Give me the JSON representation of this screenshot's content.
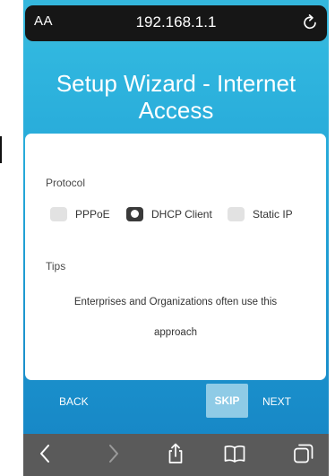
{
  "browser": {
    "text_size_button": "AA",
    "url": "192.168.1.1",
    "reload_icon": "reload-icon"
  },
  "page": {
    "title": "Setup Wizard - Internet Access"
  },
  "protocol": {
    "label": "Protocol",
    "options": [
      {
        "label": "PPPoE",
        "selected": false
      },
      {
        "label": "DHCP Client",
        "selected": true
      },
      {
        "label": "Static IP",
        "selected": false
      }
    ]
  },
  "tips": {
    "label": "Tips",
    "line1": "Enterprises and Organizations often use this",
    "line2": "approach"
  },
  "nav": {
    "back": "BACK",
    "skip": "SKIP",
    "next": "NEXT"
  },
  "toolbar": {
    "icons": [
      "back-icon",
      "forward-icon",
      "share-icon",
      "bookmarks-icon",
      "tabs-icon"
    ]
  },
  "colors": {
    "background_top": "#35bde2",
    "background_bottom": "#1583c4",
    "skip_button": "#8fcbe6",
    "url_bar": "#161616",
    "toolbar": "#5a5a5a"
  }
}
